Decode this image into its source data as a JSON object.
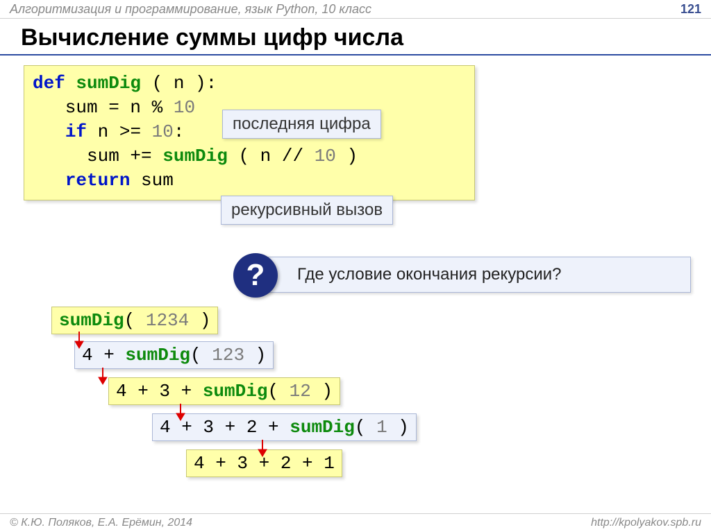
{
  "header": {
    "course": "Алгоритмизация и программирование, язык Python, 10 класс",
    "page": "121"
  },
  "title": "Вычисление суммы цифр числа",
  "code": {
    "def": "def",
    "fn": "sumDig",
    "arg_open": " ( n ):",
    "line2a": "   sum",
    "line2b": " = n % ",
    "line2c": "10",
    "line3a": "   ",
    "line3b": "if",
    "line3c": " n >= ",
    "line3d": "10",
    "line3e": ":",
    "line4a": "     sum += ",
    "line4b": "sumDig",
    "line4c": " ( n // ",
    "line4d": "10",
    "line4e": " )",
    "line5a": "   ",
    "line5b": "return",
    "line5c": " sum"
  },
  "labels": {
    "last_digit": "последняя цифра",
    "recursive_call": "рекурсивный вызов"
  },
  "question_mark": "?",
  "question": "Где условие окончания рекурсии?",
  "steps": {
    "s1a": "sumDig",
    "s1b": "( ",
    "s1c": "1234",
    "s1d": " )",
    "s2a": "4 + ",
    "s2b": "sumDig",
    "s2c": "( ",
    "s2d": "123",
    "s2e": " )",
    "s3a": "4 + 3 + ",
    "s3b": "sumDig",
    "s3c": "( ",
    "s3d": "12",
    "s3e": " )",
    "s4a": "4 + 3 + 2 + ",
    "s4b": "sumDig",
    "s4c": "( ",
    "s4d": "1",
    "s4e": " )",
    "s5": "4 + 3 + 2 + 1"
  },
  "footer": {
    "left": "© К.Ю. Поляков, Е.А. Ерёмин, 2014",
    "right": "http://kpolyakov.spb.ru"
  }
}
